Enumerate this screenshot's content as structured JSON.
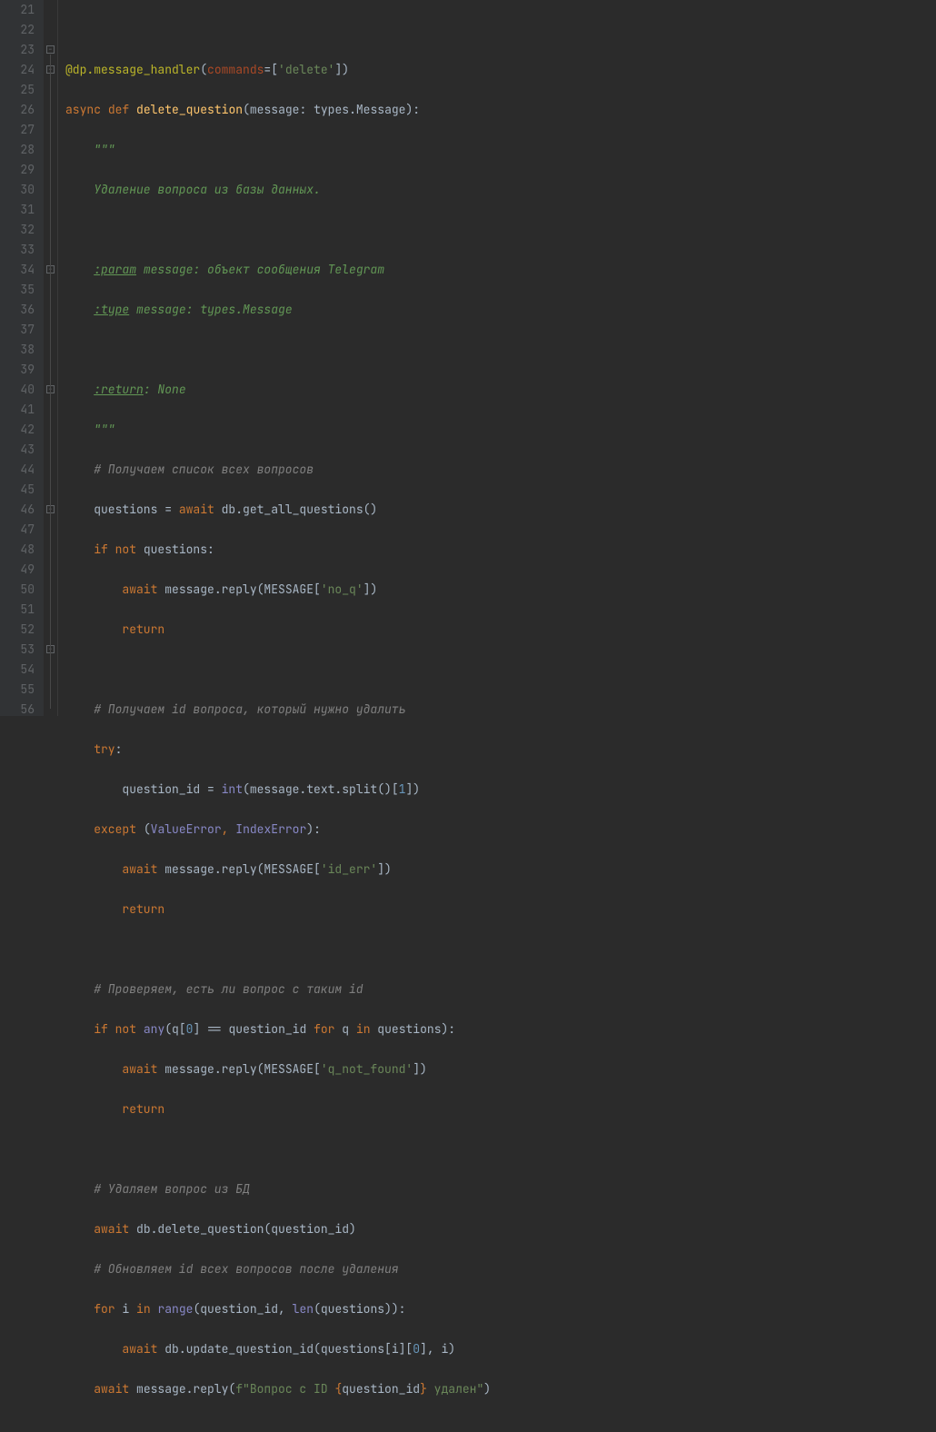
{
  "startLine": 21,
  "endLine": 56,
  "code": {
    "l21": "",
    "l22_decorator": "@dp.message_handler",
    "l22_param": "commands",
    "l22_string": "'delete'",
    "l23_async": "async",
    "l23_def": "def",
    "l23_name": "delete_question",
    "l23_param": "message: types.Message",
    "l24_doc": "\"\"\"",
    "l25_doc": "Удаление вопроса из базы данных.",
    "l27_tag": ":param",
    "l27_doc": " message: объект сообщения Telegram",
    "l28_tag": ":type",
    "l28_doc": " message: types.Message",
    "l30_tag": ":return",
    "l30_doc": ": None",
    "l31_doc": "\"\"\"",
    "l32_comment": "# Получаем список всех вопросов",
    "l33_var": "questions = ",
    "l33_await": "await",
    "l33_call": " db.get_all_questions()",
    "l34_if": "if",
    "l34_not": "not",
    "l34_rest": " questions:",
    "l35_await": "await",
    "l35_call": " message.reply(MESSAGE[",
    "l35_str": "'no_q'",
    "l35_end": "])",
    "l36_return": "return",
    "l38_comment": "# Получаем id вопроса, который нужно удалить",
    "l39_try": "try",
    "l40_var": "question_id = ",
    "l40_int": "int",
    "l40_call": "(message.text.split()[",
    "l40_num": "1",
    "l40_end": "])",
    "l41_except": "except",
    "l41_err1": "ValueError",
    "l41_err2": "IndexError",
    "l42_await": "await",
    "l42_call": " message.reply(MESSAGE[",
    "l42_str": "'id_err'",
    "l42_end": "])",
    "l43_return": "return",
    "l45_comment": "# Проверяем, есть ли вопрос с таким id",
    "l46_if": "if",
    "l46_not": "not",
    "l46_any": "any",
    "l46_q": "(q[",
    "l46_zero": "0",
    "l46_eq": "] == question_id ",
    "l46_for": "for",
    "l46_qvar": " q ",
    "l46_in": "in",
    "l46_rest": " questions):",
    "l47_await": "await",
    "l47_call": " message.reply(MESSAGE[",
    "l47_str": "'q_not_found'",
    "l47_end": "])",
    "l48_return": "return",
    "l50_comment": "# Удаляем вопрос из БД",
    "l51_await": "await",
    "l51_call": " db.delete_question(question_id)",
    "l52_comment": "# Обновляем id всех вопросов после удаления",
    "l53_for": "for",
    "l53_i": " i ",
    "l53_in": "in",
    "l53_range": "range",
    "l53_call": "(question_id, ",
    "l53_len": "len",
    "l53_end": "(questions)):",
    "l54_await": "await",
    "l54_call": " db.update_question_id(questions[i][",
    "l54_zero": "0",
    "l54_end": "], i)",
    "l55_await": "await",
    "l55_call": " message.reply(",
    "l55_f": "f\"Вопрос с ID ",
    "l55_brace1": "{",
    "l55_var": "question_id",
    "l55_brace2": "}",
    "l55_str2": " удален\"",
    "l55_end": ")"
  }
}
